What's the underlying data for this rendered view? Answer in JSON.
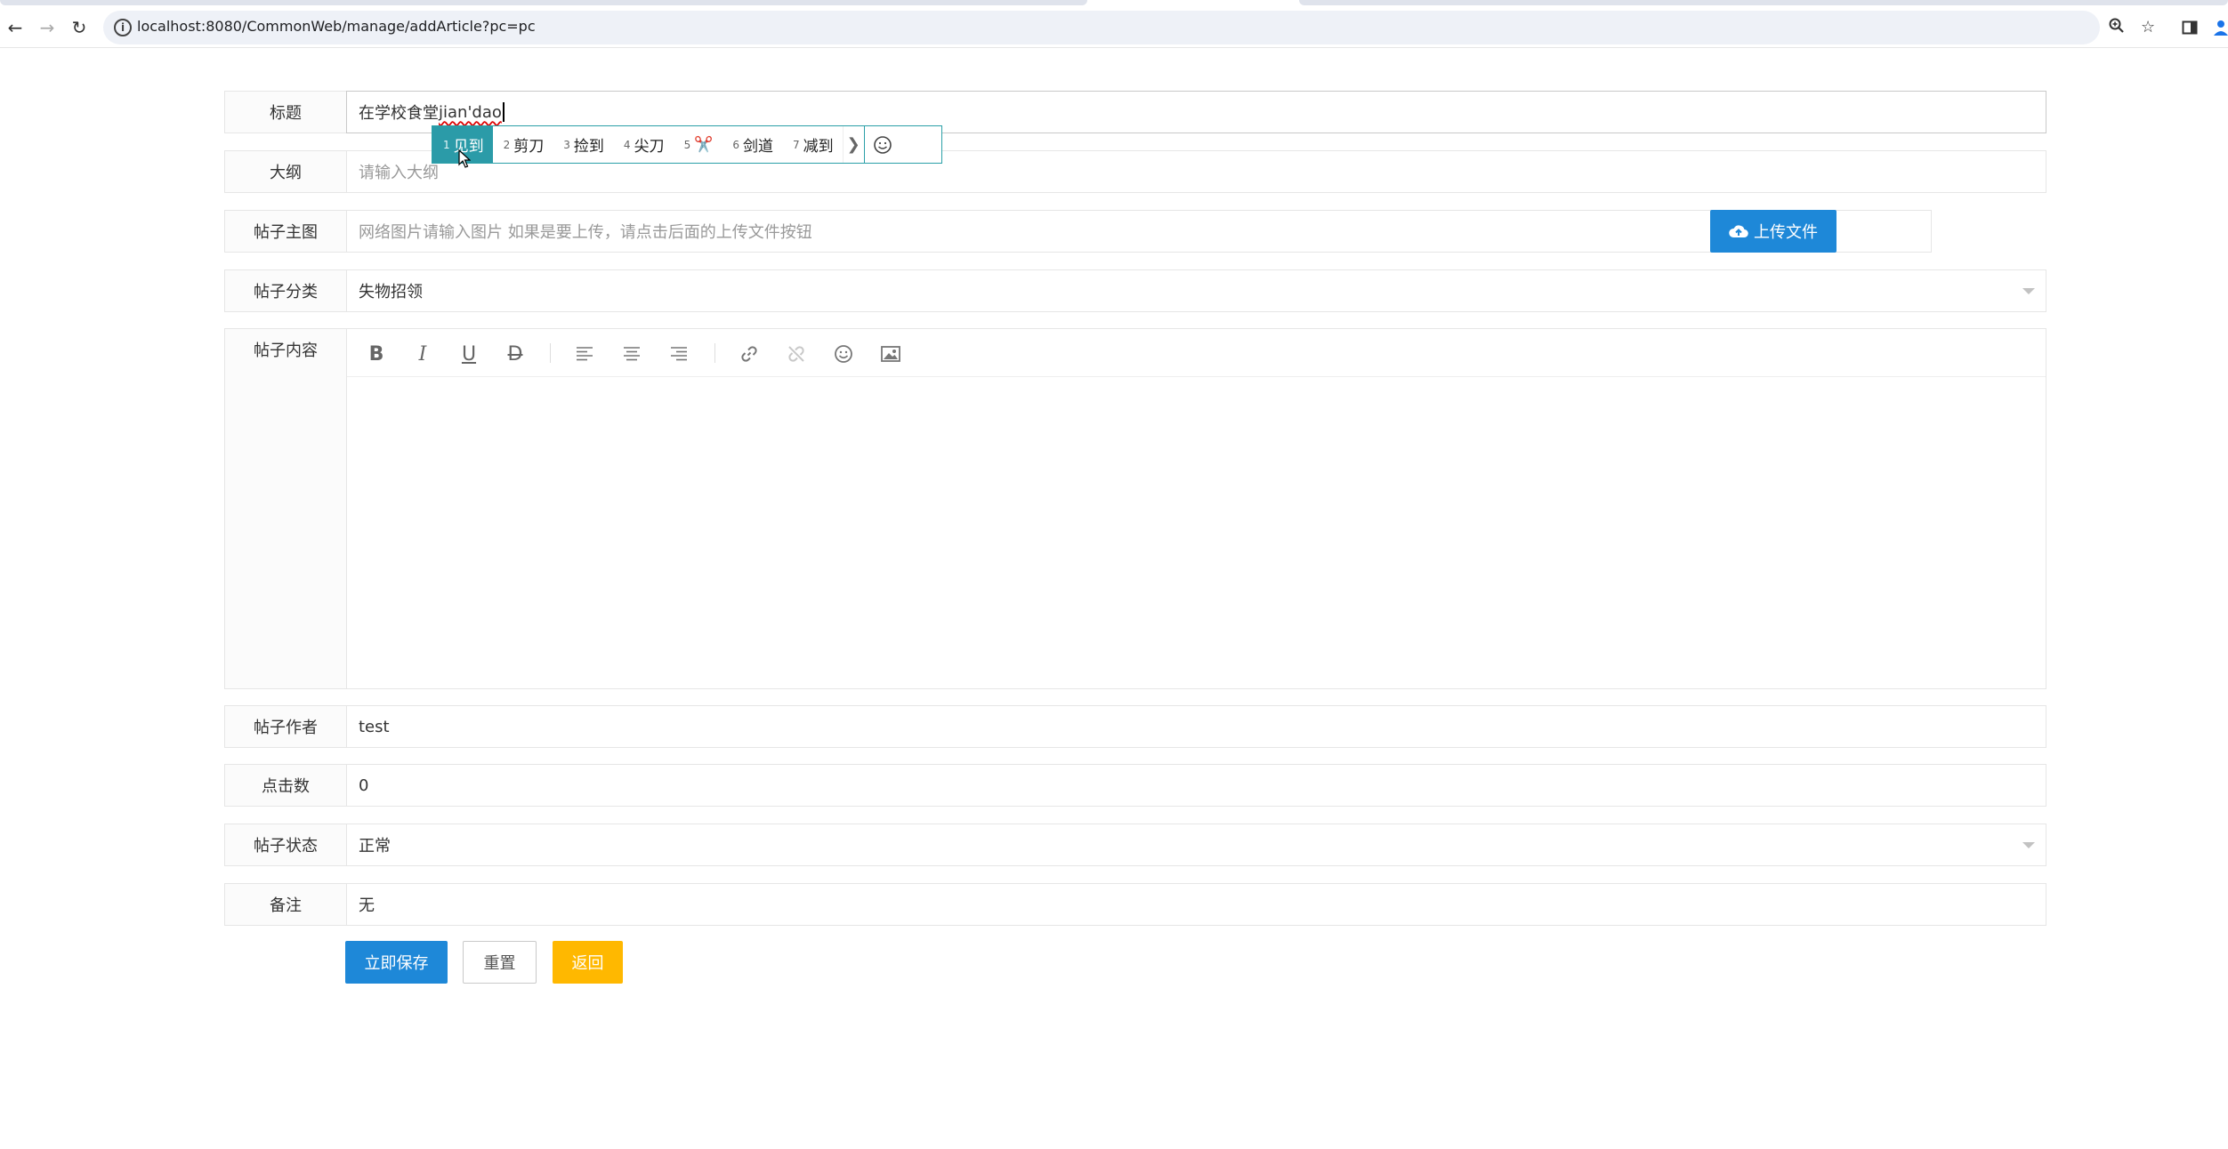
{
  "browser": {
    "url": "localhost:8080/CommonWeb/manage/addArticle?pc=pc"
  },
  "form": {
    "title": {
      "label": "标题",
      "typed": "在学校食堂",
      "composing": "jian'dao"
    },
    "outline": {
      "label": "大纲",
      "placeholder": "请输入大纲"
    },
    "main_image": {
      "label": "帖子主图",
      "placeholder": "网络图片请输入图片 如果是要上传，请点击后面的上传文件按钮",
      "upload_label": "上传文件"
    },
    "category": {
      "label": "帖子分类",
      "value": "失物招领"
    },
    "content": {
      "label": "帖子内容"
    },
    "author": {
      "label": "帖子作者",
      "value": "test"
    },
    "clicks": {
      "label": "点击数",
      "value": "0"
    },
    "status": {
      "label": "帖子状态",
      "value": "正常"
    },
    "remark": {
      "label": "备注",
      "value": "无"
    }
  },
  "editor_toolbar": {
    "bold": "B",
    "italic": "I",
    "underline": "U",
    "strike": "D"
  },
  "ime": {
    "candidates": [
      {
        "num": "1",
        "text": "见到"
      },
      {
        "num": "2",
        "text": "剪刀"
      },
      {
        "num": "3",
        "text": "捡到"
      },
      {
        "num": "4",
        "text": "尖刀"
      },
      {
        "num": "5",
        "text": "✂️"
      },
      {
        "num": "6",
        "text": "剑道"
      },
      {
        "num": "7",
        "text": "减到"
      }
    ],
    "selected_index": 0
  },
  "buttons": {
    "save": "立即保存",
    "reset": "重置",
    "back": "返回"
  },
  "colors": {
    "primary": "#1e88d8",
    "warning": "#ffb800",
    "ime_accent": "#2b9ba8"
  }
}
